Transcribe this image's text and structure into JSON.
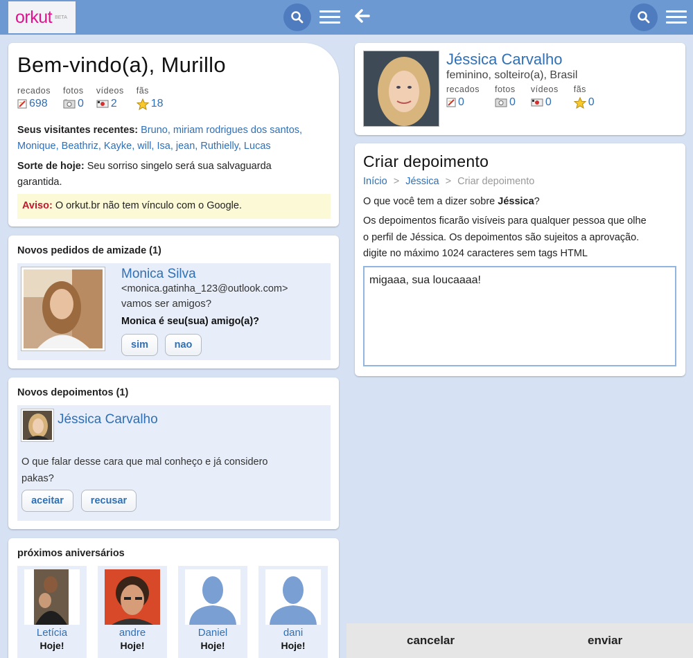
{
  "left": {
    "logo": "orkut",
    "logo_beta": "BETA",
    "welcome": "Bem-vindo(a), Murillo",
    "stats": [
      {
        "label": "recados",
        "value": "698",
        "icon": "pencil-note-icon"
      },
      {
        "label": "fotos",
        "value": "0",
        "icon": "photo-icon"
      },
      {
        "label": "vídeos",
        "value": "2",
        "icon": "video-icon"
      },
      {
        "label": "fãs",
        "value": "18",
        "icon": "star-icon"
      }
    ],
    "visitors_label": "Seus visitantes recentes:",
    "visitors_line1": "Bruno, miriam rodrigues dos santos,",
    "visitors_line2": "Monique, Beathriz, Kayke, will, Isa, jean, Ruthielly, Lucas",
    "luck_label": "Sorte de hoje:",
    "luck_line1": "Seu sorriso singelo será sua salvaguarda",
    "luck_line2": "garantida.",
    "aviso_label": "Aviso:",
    "aviso_text": "O orkut.br não tem vínculo com o Google.",
    "friend_requests": {
      "title": "Novos pedidos de amizade (1)",
      "name": "Monica Silva",
      "email": "<monica.gatinha_123@outlook.com>",
      "message": "vamos ser amigos?",
      "question": "Monica é seu(sua) amigo(a)?",
      "yes": "sim",
      "no": "nao"
    },
    "testimonials": {
      "title": "Novos depoimentos (1)",
      "name": "Jéssica Carvalho",
      "text_line1": "O que falar desse cara que mal conheço e já considero",
      "text_line2": "pakas?",
      "accept": "aceitar",
      "reject": "recusar"
    },
    "birthdays": {
      "title": "próximos aniversários",
      "people": [
        {
          "name": "Letícia",
          "when": "Hoje!"
        },
        {
          "name": "andre",
          "when": "Hoje!"
        },
        {
          "name": "Daniel",
          "when": "Hoje!"
        },
        {
          "name": "dani",
          "when": "Hoje!"
        }
      ]
    }
  },
  "right": {
    "profile": {
      "name": "Jéssica Carvalho",
      "info": "feminino, solteiro(a), Brasil",
      "stats": [
        {
          "label": "recados",
          "value": "0",
          "icon": "pencil-note-icon"
        },
        {
          "label": "fotos",
          "value": "0",
          "icon": "photo-icon"
        },
        {
          "label": "vídeos",
          "value": "0",
          "icon": "video-icon"
        },
        {
          "label": "fãs",
          "value": "0",
          "icon": "star-icon"
        }
      ]
    },
    "create": {
      "title": "Criar depoimento",
      "crumb_home": "Início",
      "crumb_sep": ">",
      "crumb_profile": "Jéssica",
      "crumb_current": "Criar depoimento",
      "question_prefix": "O que você tem a dizer sobre",
      "question_name": "Jéssica",
      "question_suffix": "?",
      "info_line1": "Os depoimentos ficarão visíveis para qualquer pessoa que olhe",
      "info_line2": "o perfil de Jéssica. Os depoimentos são sujeitos a aprovação.",
      "info_line3": "digite no máximo 1024 caracteres sem tags HTML",
      "textarea_value": "migaaa, sua loucaaaa!"
    },
    "cancel": "cancelar",
    "send": "enviar"
  },
  "colors": {
    "topbar": "#6d99d3",
    "link": "#2f6fb6",
    "brand": "#e0148c",
    "background": "#d6e2f3"
  }
}
